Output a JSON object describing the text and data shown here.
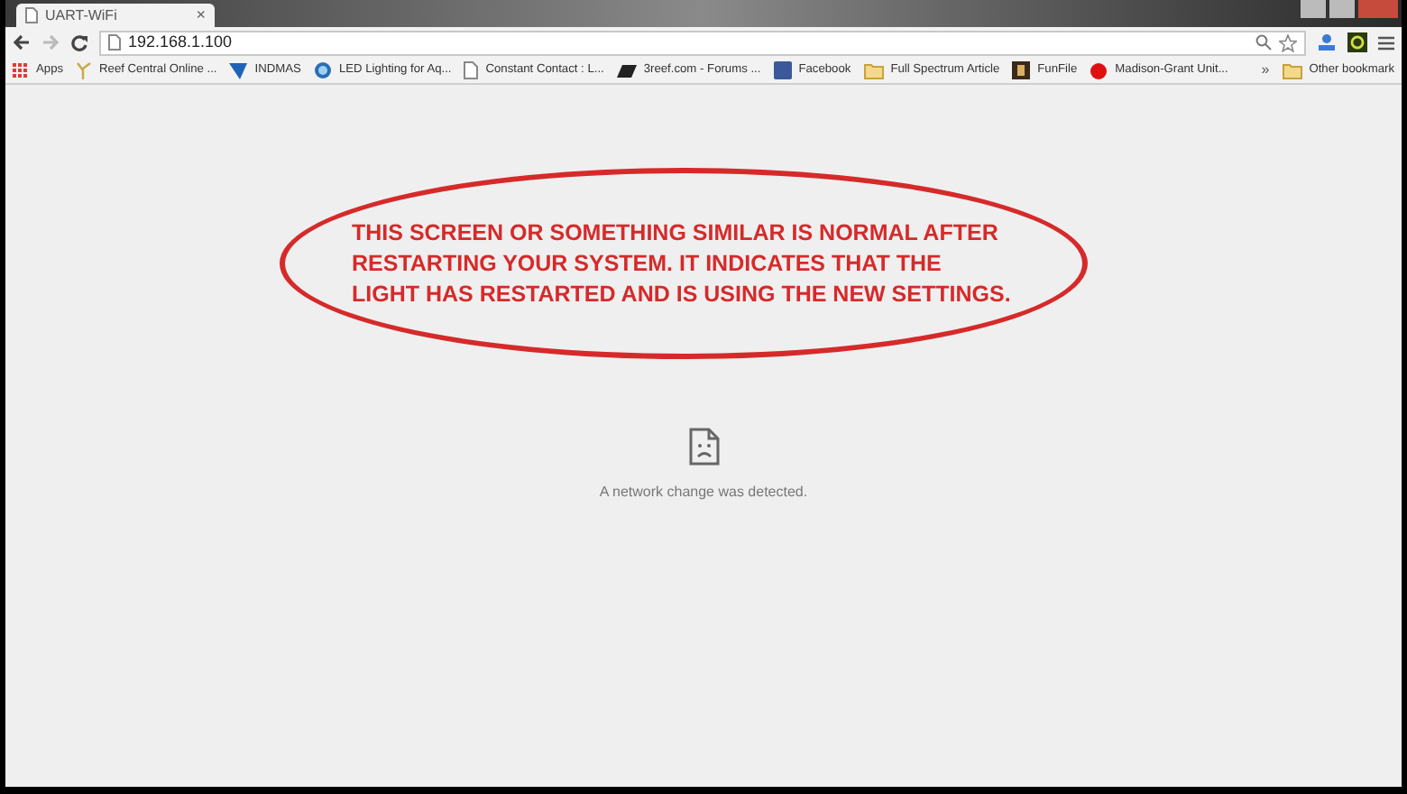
{
  "tab": {
    "title": "UART-WiFi",
    "close": "×"
  },
  "toolbar": {
    "url": "192.168.1.100"
  },
  "bookmarks": [
    {
      "kind": "apps",
      "label": "Apps"
    },
    {
      "kind": "leaf",
      "label": "Reef Central Online ..."
    },
    {
      "kind": "flag",
      "label": "INDMAS"
    },
    {
      "kind": "globe",
      "label": "LED Lighting for Aq..."
    },
    {
      "kind": "page",
      "label": "Constant Contact : L..."
    },
    {
      "kind": "logo",
      "label": "3reef.com - Forums ..."
    },
    {
      "kind": "facebook",
      "label": "Facebook"
    },
    {
      "kind": "folder",
      "label": "Full Spectrum Article"
    },
    {
      "kind": "film",
      "label": "FunFile"
    },
    {
      "kind": "apple",
      "label": "Madison-Grant Unit..."
    }
  ],
  "bookmarks_more": "»",
  "other_bookmarks": "Other bookmark",
  "annotation": {
    "lines": [
      "THIS SCREEN OR SOMETHING SIMILAR IS NORMAL AFTER",
      "RESTARTING YOUR SYSTEM. IT INDICATES THAT THE",
      "LIGHT HAS RESTARTED AND IS USING THE NEW SETTINGS."
    ]
  },
  "error": {
    "message": "A network change was detected."
  }
}
